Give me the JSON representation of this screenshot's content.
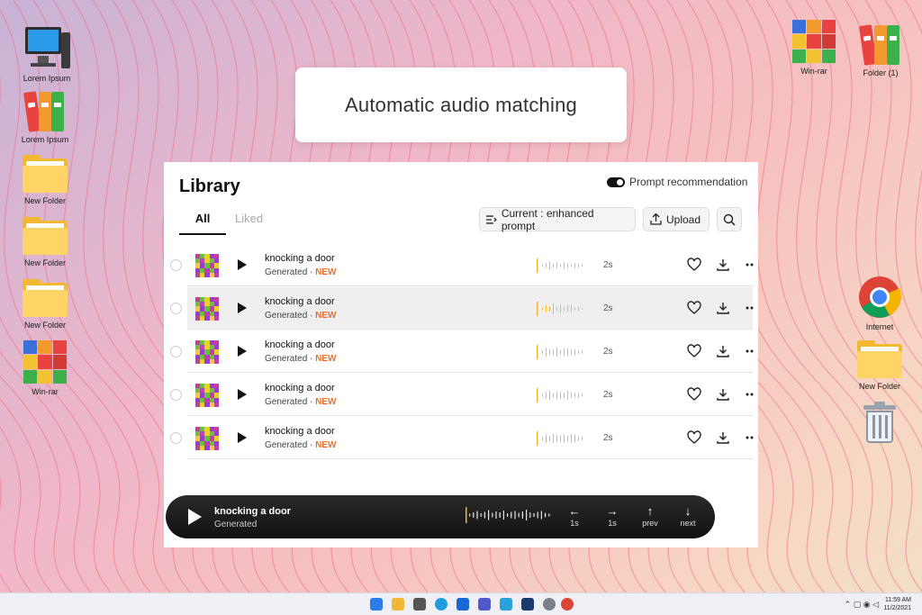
{
  "desktop": {
    "left_icons": [
      {
        "label": "Lorem Ipsum",
        "icon": "computer-icon"
      },
      {
        "label": "Lorem Ipsum",
        "icon": "binders-icon"
      },
      {
        "label": "New Folder",
        "icon": "folder-icon"
      },
      {
        "label": "New Folder",
        "icon": "folder-icon"
      },
      {
        "label": "New Folder",
        "icon": "folder-icon"
      },
      {
        "label": "Win-rar",
        "icon": "winrar-icon"
      }
    ],
    "right_icons": [
      {
        "label": "Win-rar",
        "icon": "winrar-icon"
      },
      {
        "label": "Folder (1)",
        "icon": "binders-icon"
      },
      {
        "label": "Internet",
        "icon": "chrome-icon"
      },
      {
        "label": "New Folder",
        "icon": "folder-icon"
      },
      {
        "label": "",
        "icon": "recycle-bin-icon"
      }
    ]
  },
  "banner": {
    "title": "Automatic audio matching"
  },
  "library": {
    "title": "Library",
    "toggle_label": "Prompt recommendation",
    "tabs": [
      {
        "label": "All",
        "active": true
      },
      {
        "label": "Liked",
        "active": false
      }
    ],
    "current_button": "Current : enhanced prompt",
    "upload_button": "Upload",
    "rows": [
      {
        "title": "knocking a door",
        "status": "Generated",
        "badge": "NEW",
        "duration": "2s",
        "highlighted": false
      },
      {
        "title": "knocking a door",
        "status": "Generated",
        "badge": "NEW",
        "duration": "2s",
        "highlighted": true
      },
      {
        "title": "knocking a door",
        "status": "Generated",
        "badge": "NEW",
        "duration": "2s",
        "highlighted": false
      },
      {
        "title": "knocking a door",
        "status": "Generated",
        "badge": "NEW",
        "duration": "2s",
        "highlighted": false
      },
      {
        "title": "knocking a door",
        "status": "Generated",
        "badge": "NEW",
        "duration": "2s",
        "highlighted": false
      }
    ]
  },
  "player": {
    "title": "knocking a door",
    "status": "Generated",
    "controls": [
      {
        "icon": "arrow-left-icon",
        "label": "1s"
      },
      {
        "icon": "arrow-right-icon",
        "label": "1s"
      },
      {
        "icon": "arrow-up-icon",
        "label": "prev"
      },
      {
        "icon": "arrow-down-icon",
        "label": "next"
      }
    ]
  },
  "taskbar": {
    "time": "11:59 AM",
    "date": "11/2/2021"
  },
  "colors": {
    "accent_new": "#ef6c2c",
    "waveform_marker": "#f2b834",
    "player_bg": "#1a1a1a"
  }
}
